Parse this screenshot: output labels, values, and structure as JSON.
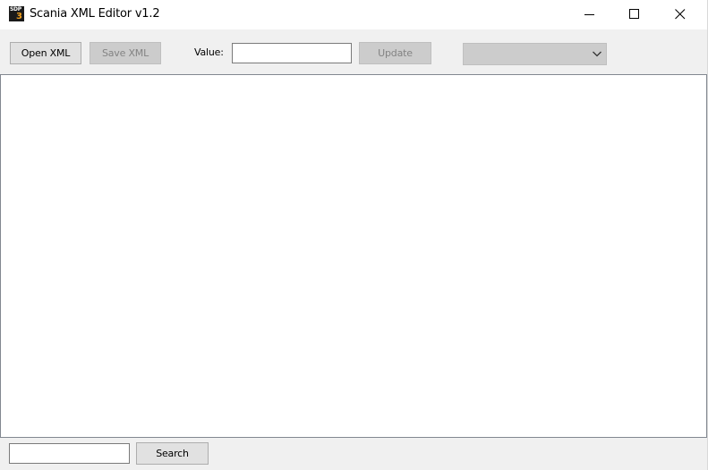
{
  "window": {
    "title": "Scania XML Editor v1.2",
    "icon": {
      "name": "sdp3-app-icon",
      "top_text": "SDP",
      "bottom_text": "3"
    },
    "controls": {
      "minimize_icon": "minimize-icon",
      "maximize_icon": "maximize-icon",
      "close_icon": "close-icon"
    }
  },
  "toolbar": {
    "open_label": "Open XML",
    "save_label": "Save XML",
    "save_enabled": false,
    "value_label": "Value:",
    "value_input": {
      "value": "",
      "placeholder": ""
    },
    "update_label": "Update",
    "update_enabled": false,
    "node_select": {
      "selected": "",
      "enabled": false
    }
  },
  "content": {
    "items": []
  },
  "bottombar": {
    "search_input": {
      "value": "",
      "placeholder": ""
    },
    "search_label": "Search"
  },
  "colors": {
    "window_bg": "#f0f0f0",
    "button_bg": "#e1e1e1",
    "disabled_bg": "#cccccc",
    "disabled_text": "#838383",
    "content_bg": "#ffffff"
  }
}
